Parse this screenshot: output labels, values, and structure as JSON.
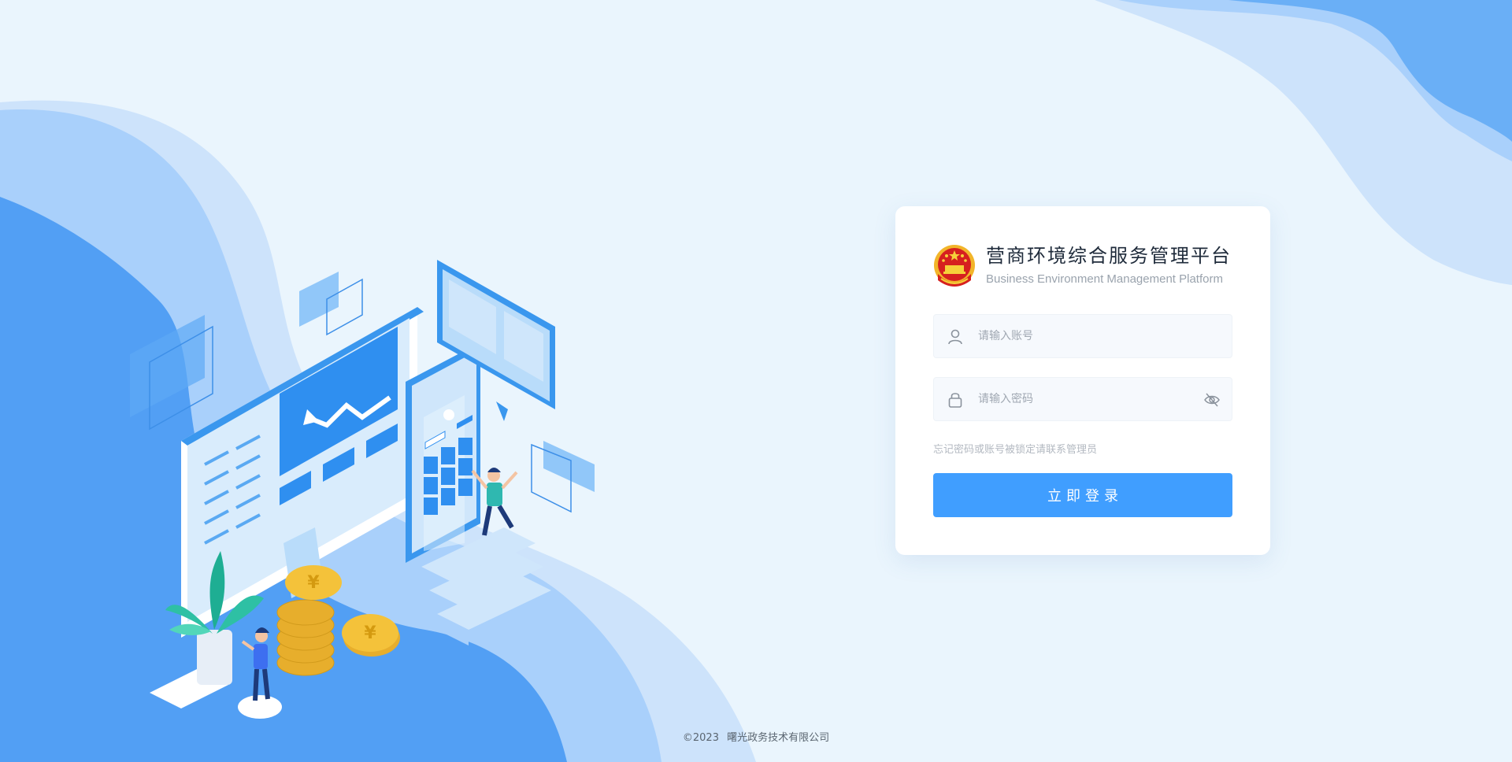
{
  "login": {
    "title": "营商环境综合服务管理平台",
    "subtitle": "Business Environment Management Platform",
    "account_placeholder": "请输入账号",
    "password_placeholder": "请输入密码",
    "hint": "忘记密码或账号被锁定请联系管理员",
    "submit_label": "立即登录"
  },
  "footer": {
    "copyright": "©2023",
    "company": "曙光政务技术有限公司"
  },
  "icons": {
    "emblem": "national-emblem-icon",
    "user": "user-icon",
    "lock": "lock-icon",
    "eye": "eye-off-icon"
  },
  "colors": {
    "primary": "#409eff",
    "background": "#eaf5fd",
    "wave_dark": "#529ff4",
    "wave_light": "#a9d0fb"
  }
}
